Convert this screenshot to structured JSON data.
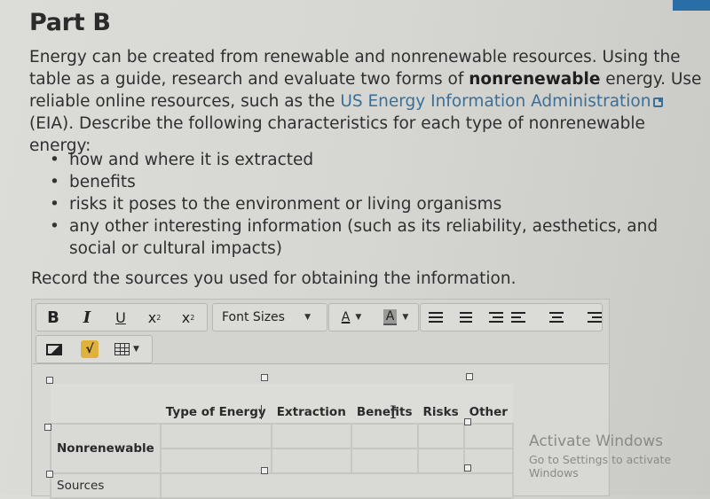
{
  "section_title": "Part B",
  "intro": {
    "part1": "Energy can be created from renewable and nonrenewable resources. Using the table as a guide, research and evaluate two forms of ",
    "bold": "nonrenewable",
    "part2": " energy. Use reliable online resources, such as the ",
    "link_text": "US Energy Information Administration",
    "link_icon": "external-link-icon",
    "part3": " (EIA). Describe the following characteristics for each type of nonrenewable energy:"
  },
  "bullets": [
    "how and where it is extracted",
    "benefits",
    "risks it poses to the environment or living organisms",
    "any other interesting information (such as its reliability, aesthetics, and social or cultural impacts)"
  ],
  "record_text": "Record the sources you used for obtaining the information.",
  "toolbar": {
    "bold": "B",
    "italic": "I",
    "underline": "U",
    "superscript": "x",
    "superscript_mark": "2",
    "subscript": "x",
    "subscript_mark": "2",
    "font_sizes": "Font Sizes",
    "text_color": "A",
    "highlight_color": "A",
    "caret": "▼",
    "sqrt": "√",
    "icons": [
      "bold-icon",
      "italic-icon",
      "underline-icon",
      "superscript-icon",
      "subscript-icon",
      "font-color-icon",
      "highlight-icon",
      "bullet-list-icon",
      "numbered-list-icon",
      "indent-icon",
      "align-left-icon",
      "align-center-icon",
      "align-right-icon",
      "image-icon",
      "math-icon",
      "table-icon"
    ],
    "accent_color": "#e0b23c"
  },
  "table": {
    "headers": [
      "",
      "Type of Energy",
      "Extraction",
      "Benefits",
      "Risks",
      "Other"
    ],
    "rows": [
      {
        "label": "Nonrenewable",
        "cells": [
          "",
          "",
          "",
          "",
          ""
        ]
      },
      {
        "label": "",
        "cells": [
          "",
          "",
          "",
          "",
          ""
        ]
      },
      {
        "label": "Sources",
        "cells": [
          ""
        ]
      }
    ]
  },
  "watermark": {
    "line1": "Activate Windows",
    "line2": "Go to Settings to activate Windows"
  },
  "colors": {
    "link": "#3a6f98",
    "corner": "#2a6ea8"
  }
}
